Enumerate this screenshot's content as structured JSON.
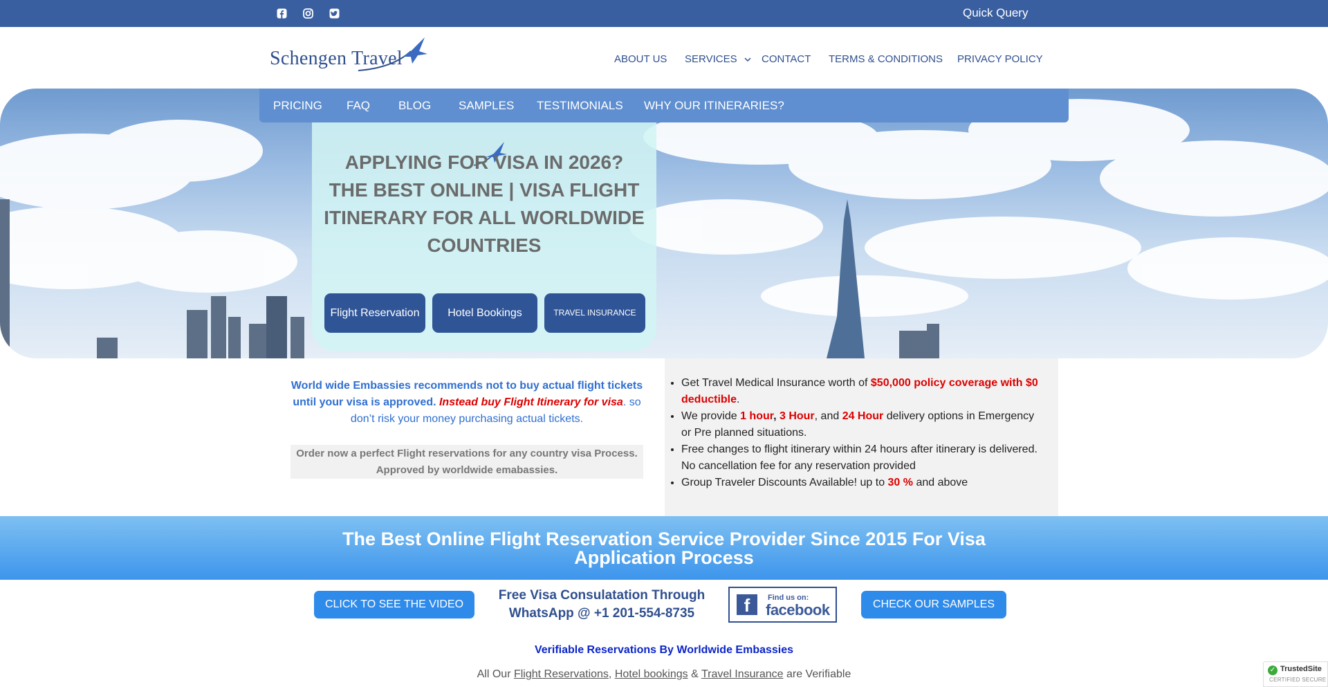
{
  "topbar": {
    "social_icons": [
      "facebook-icon",
      "instagram-icon",
      "twitter-icon"
    ],
    "quick_query": "Quick Query",
    "bg_color": "#3a5fa0"
  },
  "header": {
    "logo_text": "Schengen Travel",
    "nav": [
      {
        "label": "ABOUT US"
      },
      {
        "label": "SERVICES"
      },
      {
        "label": "CONTACT"
      },
      {
        "label": "TERMS & CONDITIONS"
      },
      {
        "label": "PRIVACY POLICY"
      }
    ]
  },
  "subnav": {
    "items": [
      {
        "label": "PRICING"
      },
      {
        "label": "FAQ"
      },
      {
        "label": "BLOG"
      },
      {
        "label": "SAMPLES"
      },
      {
        "label": "TESTIMONIALS"
      },
      {
        "label": "WHY OUR ITINERARIES?"
      }
    ]
  },
  "hero": {
    "title_line1": "APPLYING FOR VISA IN 2026?",
    "title_rest": "THE BEST ONLINE | VISA FLIGHT ITINERARY FOR ALL WORLDWIDE COUNTRIES",
    "buttons": {
      "flight": "Flight Reservation",
      "hotel": "Hotel Bookings",
      "insurance": "TRAVEL INSURANCE"
    }
  },
  "info": {
    "left": {
      "part1": "World wide Embassies  recommends not to buy actual flight tickets until your visa is approved. ",
      "part2": "Instead buy Flight  Itinerary for visa",
      "part3": ". so don’t risk your money purchasing actual tickets.",
      "order_line1": "Order now a perfect Flight reservations for any country visa Process.",
      "order_line2": "Approved by worldwide emabassies."
    },
    "right": {
      "b1_a": "Get Travel Medical Insurance worth of ",
      "b1_b": "$50,000 policy coverage with $0 deductible",
      "b1_c": ".",
      "b2_a": "We provide ",
      "b2_b": "1 hour",
      "b2_c": ", ",
      "b2_d": "3 Hour",
      "b2_e": ", and ",
      "b2_f": "24 Hour",
      "b2_g": " delivery options in Emergency or Pre planned situations.",
      "b3": "Free changes to flight itinerary within 24 hours after itinerary is delivered. No cancellation fee for any reservation provided",
      "b4_a": "Group Traveler Discounts Available! up to ",
      "b4_b": "30 %",
      "b4_c": " and above"
    }
  },
  "banner": {
    "title": "The Best Online Flight Reservation Service Provider Since 2015 For Visa Application Process"
  },
  "cta": {
    "video": "CLICK TO SEE THE VIDEO",
    "whatsapp_line1": "Free Visa Consulatation Through",
    "whatsapp_line2": "WhatsApp @ +1 201-554-8735",
    "fb_find": "Find us on:",
    "fb_word": "facebook",
    "fb_f": "f",
    "samples": "CHECK OUR SAMPLES"
  },
  "footer": {
    "verifiable": "Verifiable Reservations By Worldwide Embassies",
    "allour_a": "All Our ",
    "link1": "Flight Reservations",
    "sep1": ", ",
    "link2": "Hotel bookings",
    "sep2": " & ",
    "link3": "Travel Insurance",
    "allour_b": " are Verifiable"
  },
  "badge": {
    "name": "TrustedSite",
    "sub": "CERTIFIED SECURE"
  }
}
